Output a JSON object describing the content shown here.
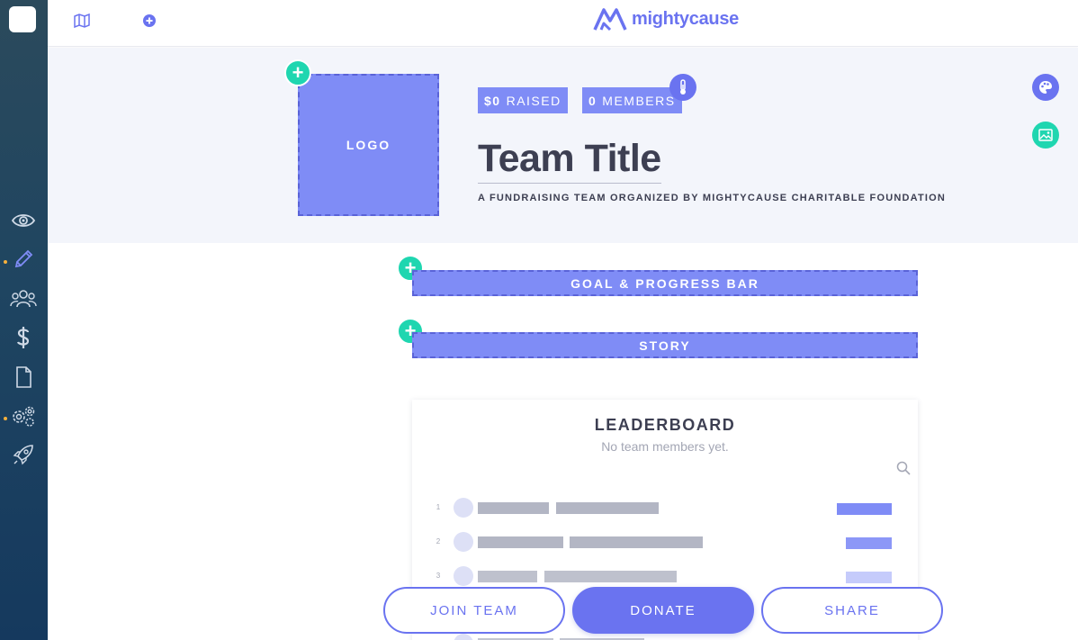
{
  "brand": {
    "name": "mightycause"
  },
  "hero": {
    "logo_label": "LOGO",
    "raised": {
      "amount": "$0",
      "label": "RAISED"
    },
    "members": {
      "count": "0",
      "label": "MEMBERS"
    },
    "title": "Team Title",
    "subtitle": "A FUNDRAISING TEAM ORGANIZED BY MIGHTYCAUSE CHARITABLE FOUNDATION"
  },
  "sections": {
    "goal_label": "GOAL & PROGRESS BAR",
    "story_label": "STORY"
  },
  "leaderboard": {
    "title": "LEADERBOARD",
    "empty_text": "No team members yet.",
    "ranks": [
      "1",
      "2",
      "3"
    ]
  },
  "actions": {
    "join_label": "JOIN TEAM",
    "donate_label": "DONATE",
    "share_label": "SHARE"
  },
  "colors": {
    "accent": "#6a73f0",
    "placeholder": "#7f8cf6",
    "add": "#1fd6b0",
    "sidebar": "#1f4561",
    "notification_dot": "#f6b03c"
  },
  "icons": {
    "sidebar": [
      "eye-icon",
      "pencil-icon",
      "users-icon",
      "dollar-icon",
      "document-icon",
      "settings-icon",
      "rocket-icon"
    ],
    "topbar": [
      "map-icon",
      "plus-circle-icon"
    ],
    "hero": [
      "thermometer-icon",
      "palette-icon",
      "image-icon"
    ]
  }
}
